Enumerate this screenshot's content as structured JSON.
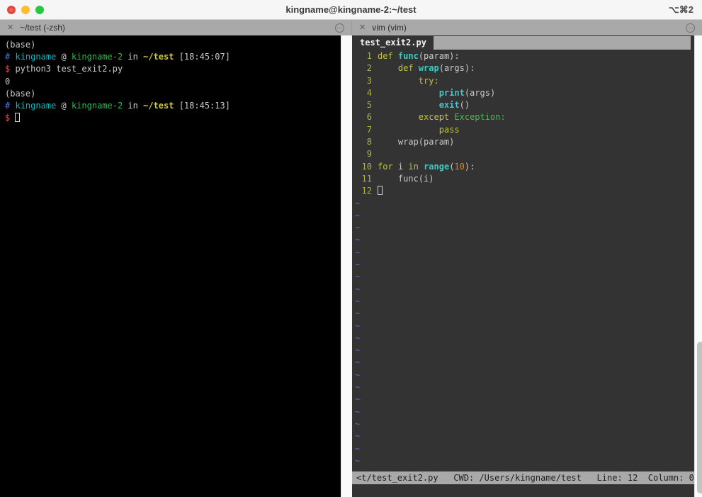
{
  "window": {
    "title": "kingname@kingname-2:~/test",
    "shortcut": "⌥⌘2"
  },
  "tabs": {
    "left": {
      "close_icon": "✕",
      "label": "~/test (-zsh)",
      "more_icon": "⋯"
    },
    "right": {
      "close_icon": "✕",
      "label": "vim (vim)",
      "more_icon": "⋯"
    }
  },
  "terminal": {
    "lines": [
      [
        {
          "t": "(base)"
        }
      ],
      [
        {
          "t": "#",
          "c": "blue"
        },
        {
          "t": " "
        },
        {
          "t": "kingname",
          "c": "cyan"
        },
        {
          "t": " @ "
        },
        {
          "t": "kingname-2",
          "c": "green"
        },
        {
          "t": " in "
        },
        {
          "t": "~/test",
          "c": "yellow"
        },
        {
          "t": " [18:45:07]"
        }
      ],
      [
        {
          "t": "$",
          "c": "red"
        },
        {
          "t": " python3 test_exit2.py"
        }
      ],
      [
        {
          "t": "0"
        }
      ],
      [
        {
          "t": "(base)"
        }
      ],
      [
        {
          "t": "#",
          "c": "blue"
        },
        {
          "t": " "
        },
        {
          "t": "kingname",
          "c": "cyan"
        },
        {
          "t": " @ "
        },
        {
          "t": "kingname-2",
          "c": "green"
        },
        {
          "t": " in "
        },
        {
          "t": "~/test",
          "c": "yellow"
        },
        {
          "t": " [18:45:13]"
        }
      ],
      [
        {
          "t": "$",
          "c": "red"
        },
        {
          "t": " "
        },
        {
          "cursor": true
        }
      ]
    ]
  },
  "vim": {
    "tab_label": "test_exit2.py",
    "lines": [
      {
        "num": "1",
        "segs": [
          {
            "t": "def",
            "c": "kw"
          },
          {
            "t": " "
          },
          {
            "t": "func",
            "c": "fn"
          },
          {
            "t": "(param):"
          }
        ]
      },
      {
        "num": "2",
        "segs": [
          {
            "t": "    "
          },
          {
            "t": "def",
            "c": "kw"
          },
          {
            "t": " "
          },
          {
            "t": "wrap",
            "c": "fn"
          },
          {
            "t": "(args):"
          }
        ]
      },
      {
        "num": "3",
        "segs": [
          {
            "t": "        "
          },
          {
            "t": "try:",
            "c": "kw"
          }
        ]
      },
      {
        "num": "4",
        "segs": [
          {
            "t": "            "
          },
          {
            "t": "print",
            "c": "fn"
          },
          {
            "t": "(args)"
          }
        ]
      },
      {
        "num": "5",
        "segs": [
          {
            "t": "            "
          },
          {
            "t": "exit",
            "c": "fn"
          },
          {
            "t": "()"
          }
        ]
      },
      {
        "num": "6",
        "segs": [
          {
            "t": "        "
          },
          {
            "t": "except",
            "c": "kw"
          },
          {
            "t": " "
          },
          {
            "t": "Exception:",
            "c": "exc"
          }
        ]
      },
      {
        "num": "7",
        "segs": [
          {
            "t": "            "
          },
          {
            "t": "pass",
            "c": "kw"
          }
        ]
      },
      {
        "num": "8",
        "segs": [
          {
            "t": "    wrap(param)"
          }
        ]
      },
      {
        "num": "9",
        "segs": []
      },
      {
        "num": "10",
        "segs": [
          {
            "t": "for",
            "c": "kw"
          },
          {
            "t": " i "
          },
          {
            "t": "in",
            "c": "kw"
          },
          {
            "t": " "
          },
          {
            "t": "range",
            "c": "fn"
          },
          {
            "t": "("
          },
          {
            "t": "10",
            "c": "numlit"
          },
          {
            "t": "):"
          }
        ]
      },
      {
        "num": "11",
        "segs": [
          {
            "t": "    func(i)"
          }
        ]
      },
      {
        "num": "12",
        "segs": [
          {
            "cursor": true
          }
        ]
      }
    ],
    "tilde_char": "~",
    "tilde_count": 22,
    "status_line": "<t/test_exit2.py   CWD: /Users/kingname/test   Line: 12  Column: 0"
  },
  "colors": {
    "title_bg": "#f6f6f6",
    "bar_gray": "#a9a9a9",
    "term_bg": "#000000",
    "term_fg": "#c9c9c9",
    "blue": "#4677d8",
    "cyan": "#00bdc3",
    "green": "#27bd4d",
    "yellow": "#cfcd26",
    "red": "#da4e57",
    "vim_bg": "#333333",
    "vim_fg": "#c9c9c9",
    "kw": "#c3c342",
    "fn": "#41c6c9",
    "exc": "#3ebd58",
    "numlit": "#c9873f",
    "linenr": "#b0b23c",
    "tilde": "#5c6bc4",
    "scrollbar_track": "#fafafa",
    "scrollbar_thumb": "#c3c3c3",
    "status_text": "#1e1e1e",
    "tab_text": "#2e2e2e",
    "title_text": "#3a3a3a"
  }
}
